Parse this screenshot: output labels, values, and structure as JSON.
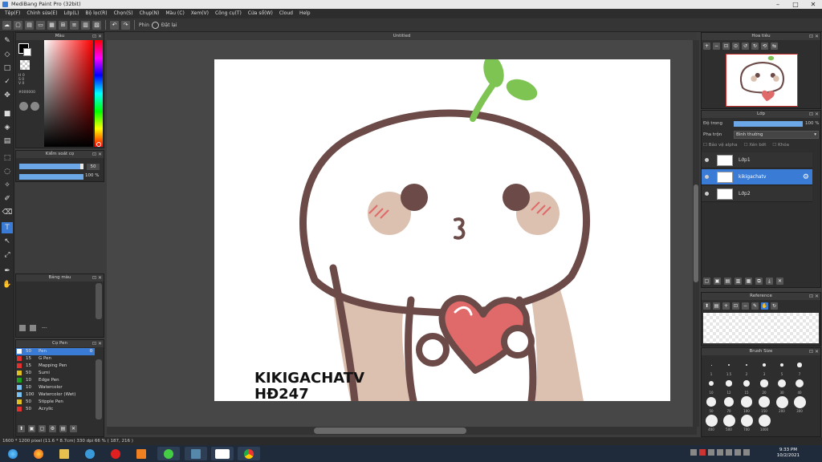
{
  "window": {
    "title": "MediBang Paint Pro (32bit)"
  },
  "menu": [
    "Tệp(F)",
    "Chỉnh sửa(E)",
    "Lớp(L)",
    "Bộ lọc(R)",
    "Chọn(S)",
    "Chụp(N)",
    "Màu (C)",
    "Xem(V)",
    "Công cụ(T)",
    "Cửa sổ(W)",
    "Cloud",
    "Help"
  ],
  "toolbar": {
    "label": "Phin",
    "mode": "Đặt lại"
  },
  "canvas_tab": {
    "title": "Untitled"
  },
  "color_panel": {
    "title": "Màu",
    "h_label": "H 0",
    "s_label": "S 0",
    "v_label": "V 0",
    "hex": "#000000"
  },
  "brush_control": {
    "title": "Kiểm soát cọ",
    "size_value": "50",
    "opacity_value": "100 %",
    "size_fraction": 0.95,
    "opacity_fraction": 1.0
  },
  "palette_panel": {
    "title": "Bảng màu",
    "empty_label": "---"
  },
  "brush_panel": {
    "title": "Cọ Pen",
    "pens": [
      {
        "size": "50",
        "name": "Pen",
        "color": "#3a7bd5"
      },
      {
        "size": "15",
        "name": "G Pen",
        "color": "#e03030"
      },
      {
        "size": "15",
        "name": "Mapping Pen",
        "color": "#e03030"
      },
      {
        "size": "50",
        "name": "Sumi",
        "color": "#e0c020"
      },
      {
        "size": "10",
        "name": "Edge Pen",
        "color": "#20a020"
      },
      {
        "size": "10",
        "name": "Watercolor",
        "color": "#7ac0f0"
      },
      {
        "size": "100",
        "name": "Watercolor (Wet)",
        "color": "#7ac0f0"
      },
      {
        "size": "50",
        "name": "Stipple Pen",
        "color": "#e0c020"
      },
      {
        "size": "50",
        "name": "Acrylic",
        "color": "#e03030"
      }
    ]
  },
  "navigator_panel": {
    "title": "Hoa tiêu"
  },
  "layer_panel": {
    "title": "Lớp",
    "opacity_label": "Độ trong",
    "opacity_value": "100 %",
    "opacity_fraction": 1.0,
    "blend_label": "Pha trộn",
    "blend_value": "Bình thường",
    "protect_alpha": "Bảo vệ alpha",
    "clipping": "Xén bớt",
    "lock": "Khóa",
    "layers": [
      {
        "name": "Lớp1",
        "selected": false
      },
      {
        "name": "kikigachatv",
        "selected": true
      },
      {
        "name": "Lớp2",
        "selected": false
      }
    ]
  },
  "reference_panel": {
    "title": "Reference"
  },
  "brush_size_panel": {
    "title": "Brush Size",
    "sizes": [
      "1",
      "1.5",
      "2",
      "3",
      "5",
      "7",
      "10",
      "12",
      "15",
      "20",
      "30",
      "40",
      "50",
      "70",
      "100",
      "150",
      "200",
      "300",
      "400",
      "500",
      "700",
      "1000"
    ]
  },
  "artwork": {
    "caption_line1": "KIKIGACHATV",
    "caption_line2": "HĐ247"
  },
  "statusbar": {
    "text": "1600 * 1200 pixel  (11.6 * 8.7cm)  330 dpi  66 %  ( 187, 216 )"
  },
  "taskbar": {
    "time": "9:33 PM",
    "date": "10/2/2021"
  },
  "colors": {
    "accent": "#3a7bd5",
    "skin_outline": "#6b4a48",
    "blush": "#e8a8a0",
    "heart": "#e06a6a",
    "sprout": "#7dc452"
  }
}
